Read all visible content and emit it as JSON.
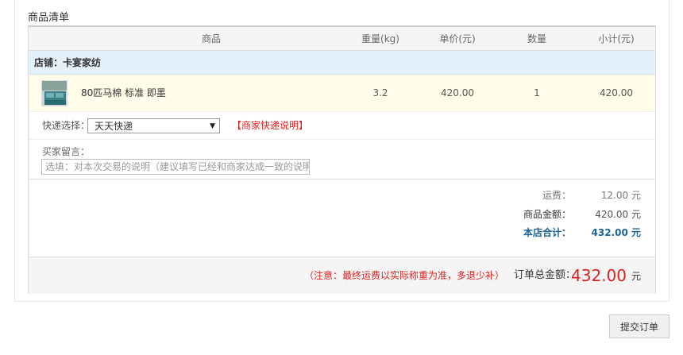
{
  "section_title": "商品清单",
  "columns": {
    "product": "商品",
    "weight": "重量(kg)",
    "unit_price": "单价(元)",
    "quantity": "数量",
    "subtotal": "小计(元)"
  },
  "shop": {
    "label": "店铺：卡宴家纺"
  },
  "item": {
    "name": "80匹马棉 标准 即墨",
    "weight": "3.2",
    "unit_price": "420.00",
    "quantity": "1",
    "subtotal": "420.00"
  },
  "shipping": {
    "label": "快递选择：",
    "selected": "天天快递",
    "link": "【商家快递说明】"
  },
  "message": {
    "label": "买家留言：",
    "placeholder": "选填：对本次交易的说明（建议填写已经和商家达成一致的说明）"
  },
  "summary": {
    "shipping_label": "运费：",
    "shipping_value": "12.00 元",
    "goods_label": "商品金额：",
    "goods_value": "420.00 元",
    "shop_total_label": "本店合计：",
    "shop_total_value": "432.00 元"
  },
  "footer": {
    "notice": "（注意：最终运费以实际称重为准，多退少补）",
    "total_label": "订单总金额：",
    "total_amount": "432.00",
    "total_unit": "元"
  },
  "submit_label": "提交订单",
  "colors": {
    "accent_red": "#e02020",
    "shop_total_blue": "#1a6496",
    "shop_row_bg": "#e4f1fb",
    "item_row_bg": "#fffdea"
  }
}
